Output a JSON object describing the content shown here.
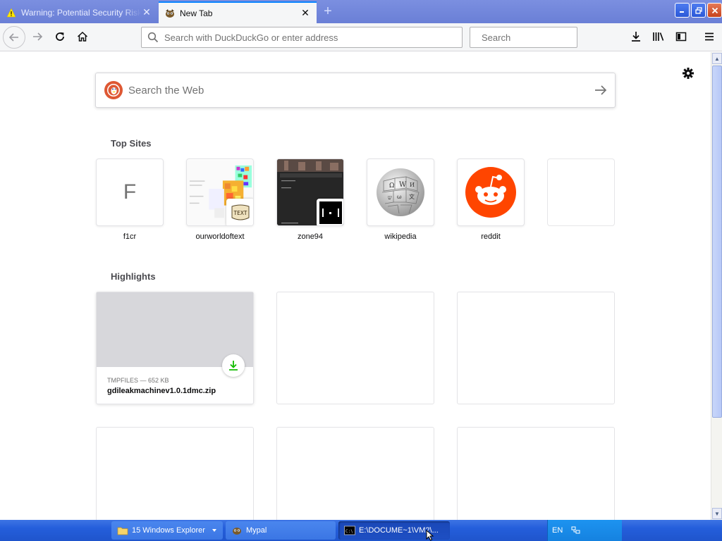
{
  "tabs": [
    {
      "title": "Warning: Potential Security Risk Ahead",
      "favicon": "warning-icon",
      "active": false
    },
    {
      "title": "New Tab",
      "favicon": "mypal-icon",
      "active": true
    }
  ],
  "navbar": {
    "url_placeholder": "Search with DuckDuckGo or enter address",
    "search_placeholder": "Search"
  },
  "newtab": {
    "web_search_placeholder": "Search the Web",
    "top_sites_heading": "Top Sites",
    "top_sites": [
      {
        "label": "f1cr",
        "letter": "F"
      },
      {
        "label": "ourworldoftext"
      },
      {
        "label": "zone94"
      },
      {
        "label": "wikipedia"
      },
      {
        "label": "reddit"
      },
      {
        "label": ""
      }
    ],
    "highlights_heading": "Highlights",
    "highlights": [
      {
        "meta": "TMPFILES — 652 KB",
        "title": "gdileakmachinev1.0.1dmc.zip",
        "icon": "download-icon"
      }
    ]
  },
  "taskbar": {
    "items": [
      {
        "label": "15 Windows Explorer",
        "icon": "folder-icon"
      },
      {
        "label": "Mypal",
        "icon": "mypal-icon"
      },
      {
        "label": "E:\\DOCUME~1\\VM2\\...",
        "icon": "cmd-icon"
      }
    ],
    "tray_lang": "EN"
  },
  "colors": {
    "accent": "#0a84ff",
    "taskbar": "#245edb",
    "ddg": "#de5833",
    "reddit": "#ff4500",
    "download": "#12bc00"
  }
}
